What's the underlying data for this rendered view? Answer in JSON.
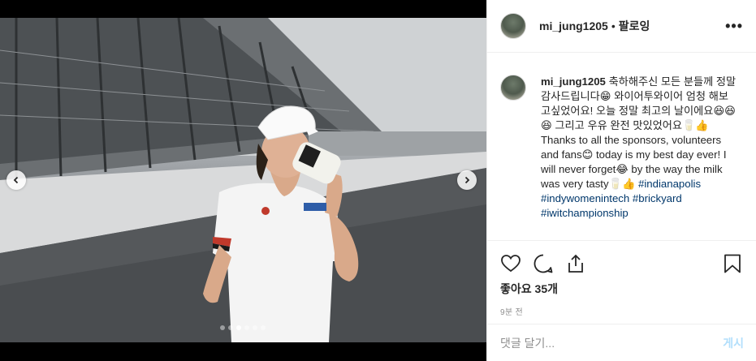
{
  "post": {
    "photo_alt": "",
    "carousel": {
      "slide_count": 6,
      "active_index": 2
    }
  },
  "header": {
    "username": "mi_jung1205",
    "separator": "•",
    "follow_label": "팔로잉",
    "more_label": "•••"
  },
  "caption": {
    "username": "mi_jung1205",
    "text_1": " 축하해주신 모든 분들께 정말 감사드립니다😁 와이어투와이어 엄청 해보고싶었어요! 오늘 정말 최고의 날이에요😆😆😆 그리고 우유 완전 맛있었어요🥛👍 Thanks to all the sponsors, volunteers and fans😊 today is my best day ever! I will never forget😂 by the way the milk was very tasty🥛👍 ",
    "tags": [
      "#indianapolis",
      "#indywomenintech",
      "#brickyard",
      "#iwitchampionship"
    ]
  },
  "stats": {
    "likes": "좋아요 35개",
    "time": "9분 전"
  },
  "comment": {
    "placeholder": "댓글 달기...",
    "post_label": "게시"
  },
  "colors": {
    "link": "#00376b",
    "post_button_disabled": "#b2dffc",
    "border": "#efefef"
  },
  "icons": [
    "chevron-left-icon",
    "chevron-right-icon",
    "heart-icon",
    "comment-icon",
    "share-icon",
    "bookmark-icon",
    "more-icon"
  ]
}
